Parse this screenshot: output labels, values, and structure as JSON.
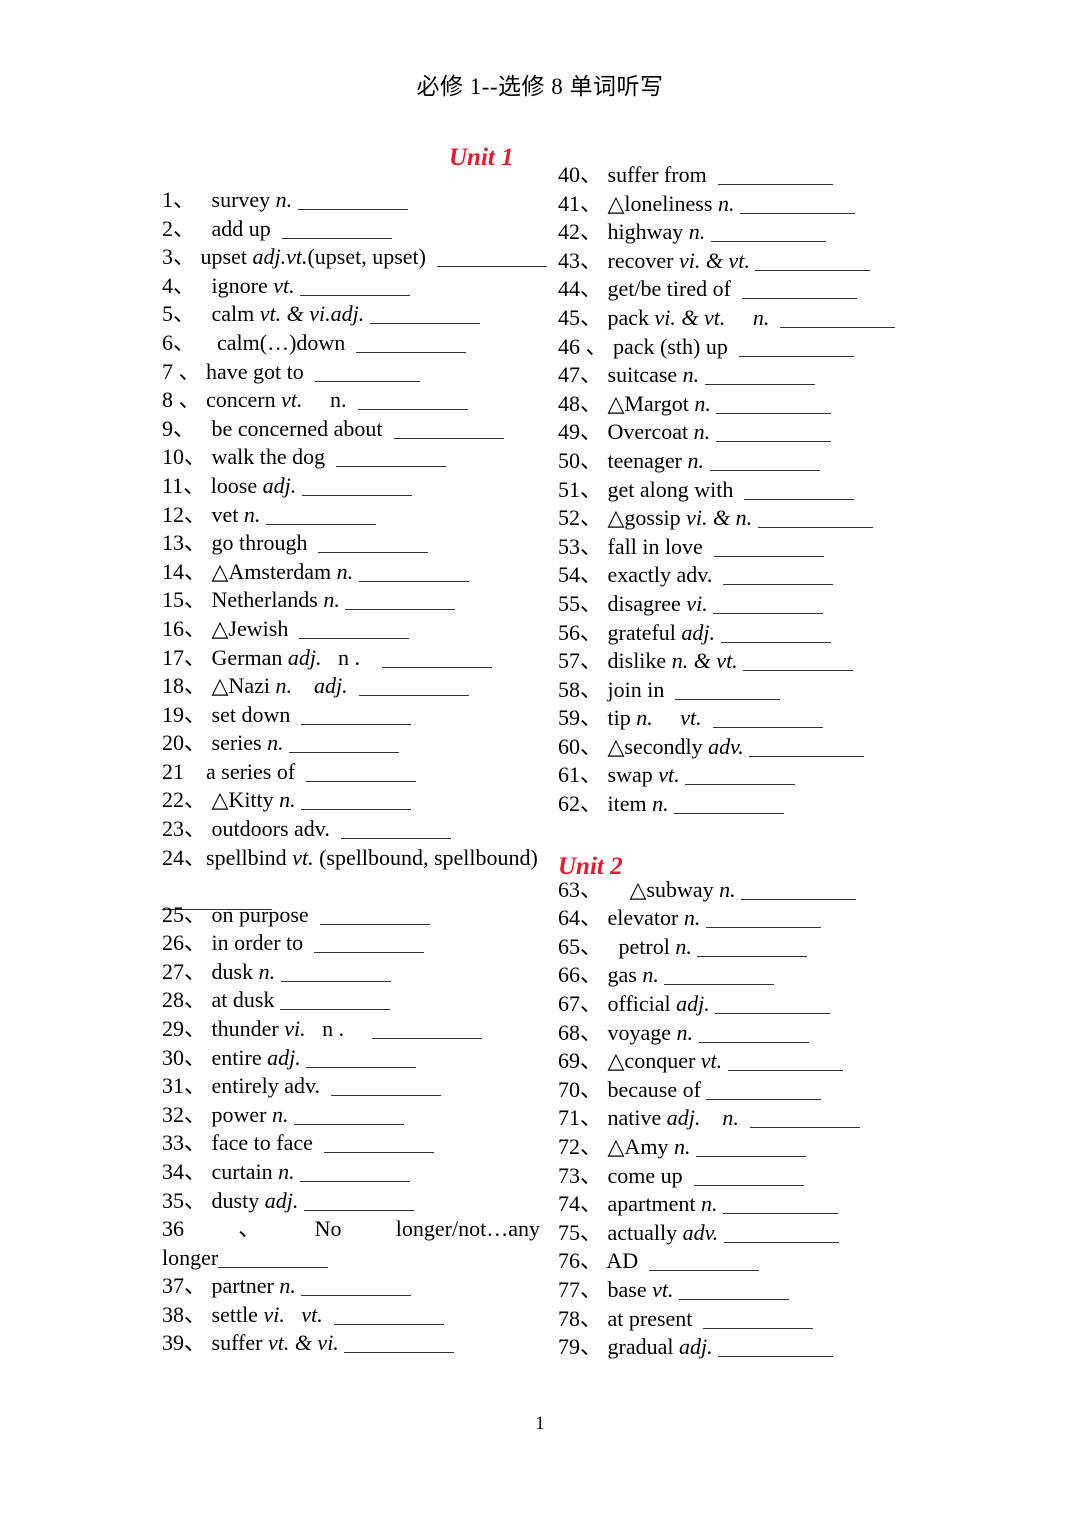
{
  "document": {
    "title": "必修 1--选修 8 单词听写",
    "page_number": "1",
    "heading_color": "#e8192c",
    "marker_symbol": "△",
    "separator": "、"
  },
  "units": [
    {
      "id": "unit1",
      "label": "Unit 1"
    },
    {
      "id": "unit2",
      "label": "Unit 2"
    }
  ],
  "left_column": [
    {
      "num": "1、",
      "text": "   survey ",
      "pos": "n.",
      "pos_italic": true,
      "blank": 110
    },
    {
      "num": "2、",
      "text": "   add up ",
      "pos": "",
      "pos_italic": false,
      "blank": 110
    },
    {
      "num": "3、",
      "text": " upset ",
      "pos": "adj.vt.",
      "pos_italic": true,
      "suffix": "(upset, upset) ",
      "blank": 110
    },
    {
      "num": "4、",
      "text": "   ignore ",
      "pos": "vt.",
      "pos_italic": true,
      "blank": 110
    },
    {
      "num": "5、",
      "text": "   calm ",
      "pos": "vt. & vi.adj.",
      "pos_italic": true,
      "blank": 110
    },
    {
      "num": "6、",
      "text": "    calm(…)down ",
      "pos": "",
      "pos_italic": false,
      "blank": 110
    },
    {
      "num": "7 、",
      "text": " have got to ",
      "pos": "",
      "pos_italic": false,
      "blank": 105
    },
    {
      "num": "8 、",
      "text": " concern ",
      "pos": "vt.",
      "pos_italic": true,
      "suffix": "     n. ",
      "blank": 110
    },
    {
      "num": "9、",
      "text": "   be concerned about ",
      "pos": "",
      "pos_italic": false,
      "blank": 110
    },
    {
      "num": "10、",
      "text": " walk the dog ",
      "pos": "",
      "pos_italic": false,
      "blank": 110
    },
    {
      "num": "11、",
      "text": " loose ",
      "pos": "adj.",
      "pos_italic": true,
      "blank": 110
    },
    {
      "num": "12、",
      "text": " vet ",
      "pos": "n.",
      "pos_italic": true,
      "blank": 110
    },
    {
      "num": "13、",
      "text": " go through ",
      "pos": "",
      "pos_italic": false,
      "blank": 110
    },
    {
      "num": "14、",
      "text": " △Amsterdam ",
      "pos": "n.",
      "pos_italic": true,
      "blank": 110
    },
    {
      "num": "15、",
      "text": " Netherlands ",
      "pos": "n.",
      "pos_italic": true,
      "blank": 110
    },
    {
      "num": "16、",
      "text": " △Jewish ",
      "pos": "",
      "pos_italic": false,
      "blank": 110
    },
    {
      "num": "17、",
      "text": " German ",
      "pos": "adj.",
      "pos_italic": true,
      "suffix": "   n .   ",
      "blank": 110
    },
    {
      "num": "18、",
      "text": " △Nazi ",
      "pos": "n.",
      "pos_italic": true,
      "suffix": "    adj. ",
      "suffix_italic": true,
      "blank": 110
    },
    {
      "num": "19、",
      "text": " set down ",
      "pos": "",
      "pos_italic": false,
      "blank": 110
    },
    {
      "num": "20、",
      "text": " series ",
      "pos": "n.",
      "pos_italic": true,
      "blank": 110
    },
    {
      "num": "21",
      "text": "    a series of ",
      "pos": "",
      "pos_italic": false,
      "blank": 110
    },
    {
      "num": "22、",
      "text": " △Kitty ",
      "pos": "n.",
      "pos_italic": true,
      "blank": 110
    },
    {
      "num": "23、",
      "text": " outdoors adv. ",
      "pos": "",
      "pos_italic": false,
      "blank": 110
    },
    {
      "num": "24、",
      "text": "spellbind ",
      "pos": "vt.",
      "pos_italic": true,
      "suffix": " (spellbound, spellbound)",
      "wrap": true,
      "blank": 110
    },
    {
      "num": "25、",
      "text": " on purpose ",
      "pos": "",
      "pos_italic": false,
      "blank": 110
    },
    {
      "num": "26、",
      "text": " in order to ",
      "pos": "",
      "pos_italic": false,
      "blank": 110
    },
    {
      "num": "27、",
      "text": " dusk ",
      "pos": "n.",
      "pos_italic": true,
      "blank": 110
    },
    {
      "num": "28、",
      "text": " at dusk",
      "pos": "",
      "pos_italic": false,
      "blank": 110
    },
    {
      "num": "29、",
      "text": " thunder ",
      "pos": "vi.",
      "pos_italic": true,
      "suffix": "   n .    ",
      "blank": 110
    },
    {
      "num": "30、",
      "text": " entire ",
      "pos": "adj.",
      "pos_italic": true,
      "blank": 110
    },
    {
      "num": "31、",
      "text": " entirely adv. ",
      "pos": "",
      "pos_italic": false,
      "blank": 110
    },
    {
      "num": "32、",
      "text": " power ",
      "pos": "n.",
      "pos_italic": true,
      "blank": 110
    },
    {
      "num": "33、",
      "text": " face to face ",
      "pos": "",
      "pos_italic": false,
      "blank": 110
    },
    {
      "num": "34、",
      "text": " curtain ",
      "pos": "n.",
      "pos_italic": true,
      "blank": 110
    },
    {
      "num": "35、",
      "text": " dusty ",
      "pos": "adj.",
      "pos_italic": true,
      "blank": 110
    },
    {
      "num": "36",
      "justified": [
        "、",
        "No",
        "longer/not…any"
      ],
      "cont": "longer",
      "wrap36": true,
      "blank": 110
    },
    {
      "num": "37、",
      "text": " partner ",
      "pos": "n.",
      "pos_italic": true,
      "blank": 110
    },
    {
      "num": "38、",
      "text": " settle ",
      "pos": "vi.",
      "pos_italic": true,
      "suffix": "   vt. ",
      "suffix_italic": true,
      "blank": 110
    },
    {
      "num": "39、",
      "text": " suffer ",
      "pos": "vt. & vi.",
      "pos_italic": true,
      "blank": 110
    }
  ],
  "right_column": [
    {
      "num": "40、",
      "text": " suffer from ",
      "pos": "",
      "pos_italic": false,
      "blank": 115
    },
    {
      "num": "41、",
      "text": " △loneliness ",
      "pos": "n.",
      "pos_italic": true,
      "blank": 115
    },
    {
      "num": "42、",
      "text": " highway ",
      "pos": "n.",
      "pos_italic": true,
      "blank": 115
    },
    {
      "num": "43、",
      "text": " recover ",
      "pos": "vi. & vt.",
      "pos_italic": true,
      "blank": 115
    },
    {
      "num": "44、",
      "text": " get/be tired of ",
      "pos": "",
      "pos_italic": false,
      "blank": 115
    },
    {
      "num": "45、",
      "text": " pack ",
      "pos": "vi. & vt.",
      "pos_italic": true,
      "suffix": "     n. ",
      "suffix_italic": true,
      "blank": 115
    },
    {
      "num": "46 、",
      "text": " pack (sth) up ",
      "pos": "",
      "pos_italic": false,
      "blank": 115
    },
    {
      "num": "47、",
      "text": " suitcase ",
      "pos": "n.",
      "pos_italic": true,
      "blank": 110
    },
    {
      "num": "48、",
      "text": " △Margot ",
      "pos": "n.",
      "pos_italic": true,
      "blank": 115
    },
    {
      "num": "49、",
      "text": " Overcoat ",
      "pos": "n.",
      "pos_italic": true,
      "blank": 115
    },
    {
      "num": "50、",
      "text": " teenager ",
      "pos": "n.",
      "pos_italic": true,
      "blank": 110
    },
    {
      "num": "51、",
      "text": " get along with ",
      "pos": "",
      "pos_italic": false,
      "blank": 110
    },
    {
      "num": "52、",
      "text": " △gossip ",
      "pos": "vi. & n.",
      "pos_italic": true,
      "blank": 115
    },
    {
      "num": "53、",
      "text": " fall in love ",
      "pos": "",
      "pos_italic": false,
      "blank": 110
    },
    {
      "num": "54、",
      "text": " exactly adv. ",
      "pos": "",
      "pos_italic": false,
      "blank": 110
    },
    {
      "num": "55、",
      "text": " disagree ",
      "pos": "vi.",
      "pos_italic": true,
      "blank": 110
    },
    {
      "num": "56、",
      "text": " grateful ",
      "pos": "adj.",
      "pos_italic": true,
      "blank": 110
    },
    {
      "num": "57、",
      "text": " dislike ",
      "pos": "n. & vt.",
      "pos_italic": true,
      "blank": 110
    },
    {
      "num": "58、",
      "text": " join in ",
      "pos": "",
      "pos_italic": false,
      "blank": 105
    },
    {
      "num": "59、",
      "text": " tip ",
      "pos": "n.",
      "pos_italic": true,
      "suffix": "     vt. ",
      "suffix_italic": true,
      "blank": 110
    },
    {
      "num": "60、",
      "text": " △secondly ",
      "pos": "adv.",
      "pos_italic": true,
      "blank": 115
    },
    {
      "num": "61、",
      "text": " swap ",
      "pos": "vt.",
      "pos_italic": true,
      "blank": 110
    },
    {
      "num": "62、",
      "text": " item ",
      "pos": "n.",
      "pos_italic": true,
      "blank": 110
    },
    {
      "num": "63、",
      "text": "  △subway ",
      "pos": "n.",
      "pos_italic": true,
      "prepad": "   ",
      "blank": 115,
      "unit_break": true
    },
    {
      "num": "64、",
      "text": " elevator ",
      "pos": "n.",
      "pos_italic": true,
      "blank": 115
    },
    {
      "num": "65、",
      "text": " petrol ",
      "pos": "n.",
      "pos_italic": true,
      "prepad": "  ",
      "blank": 110
    },
    {
      "num": "66、",
      "text": " gas ",
      "pos": "n.",
      "pos_italic": true,
      "blank": 110
    },
    {
      "num": "67、",
      "text": " official ",
      "pos": "adj.",
      "pos_italic": true,
      "blank": 115
    },
    {
      "num": "68、",
      "text": " voyage ",
      "pos": "n.",
      "pos_italic": true,
      "blank": 110
    },
    {
      "num": "69、",
      "text": " △conquer ",
      "pos": "vt.",
      "pos_italic": true,
      "blank": 115
    },
    {
      "num": "70、",
      "text": " because of",
      "pos": "",
      "pos_italic": false,
      "blank": 115
    },
    {
      "num": "71、",
      "text": " native ",
      "pos": "adj.",
      "pos_italic": true,
      "suffix": "    n. ",
      "suffix_italic": true,
      "blank": 110
    },
    {
      "num": "72、",
      "text": " △Amy ",
      "pos": "n.",
      "pos_italic": true,
      "blank": 110
    },
    {
      "num": "73、",
      "text": " come up ",
      "pos": "",
      "pos_italic": false,
      "blank": 110
    },
    {
      "num": "74、",
      "text": " apartment ",
      "pos": "n.",
      "pos_italic": true,
      "blank": 115
    },
    {
      "num": "75、",
      "text": " actually ",
      "pos": "adv.",
      "pos_italic": true,
      "blank": 115
    },
    {
      "num": "76、",
      "text": " AD ",
      "pos": "",
      "pos_italic": false,
      "blank": 110
    },
    {
      "num": "77、",
      "text": " base ",
      "pos": "vt.",
      "pos_italic": true,
      "blank": 110
    },
    {
      "num": "78、",
      "text": " at present ",
      "pos": "",
      "pos_italic": false,
      "blank": 110
    },
    {
      "num": "79、",
      "text": " gradual ",
      "pos": "adj.",
      "pos_italic": true,
      "blank": 115
    }
  ]
}
